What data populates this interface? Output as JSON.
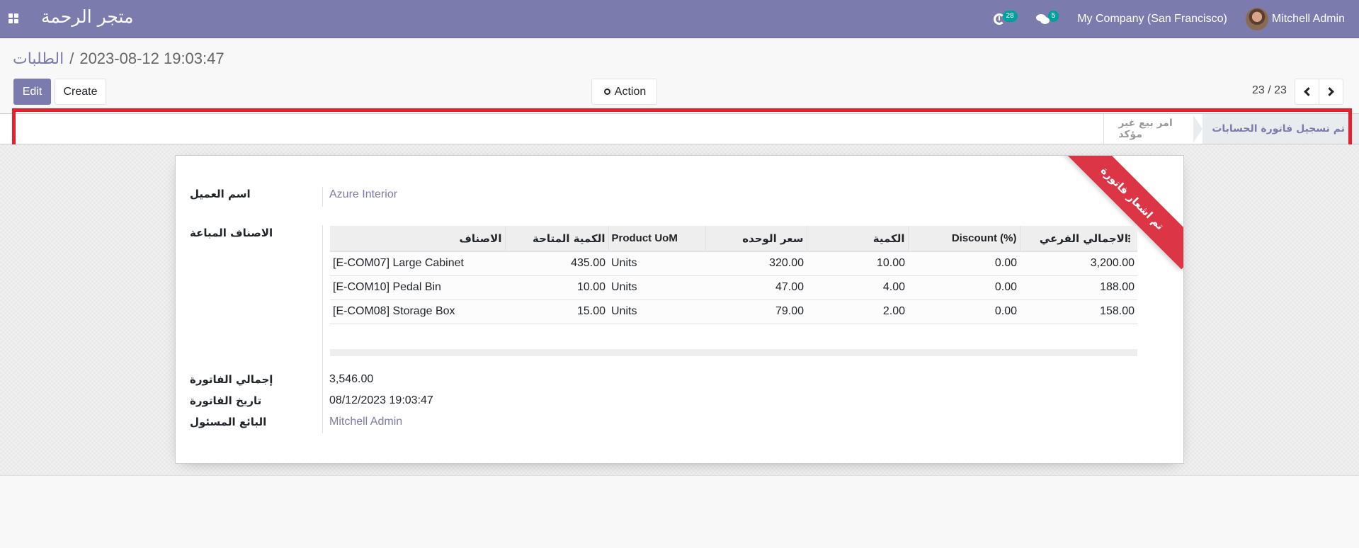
{
  "navbar": {
    "app_title": "متجر الرحمة",
    "activity_count": "28",
    "message_count": "5",
    "company": "My Company (San Francisco)",
    "user": "Mitchell Admin"
  },
  "breadcrumb": {
    "parent": "الطلبات",
    "separator": "/",
    "current": "2023-08-12 19:03:47"
  },
  "toolbar": {
    "edit_label": "Edit",
    "create_label": "Create",
    "action_label": "Action"
  },
  "pager": {
    "value": "23 / 23"
  },
  "statusbar": {
    "steps": [
      {
        "label": "تم تسجيل فاتورة الحسابات",
        "active": true
      },
      {
        "label": "امر بيع غير مؤكد",
        "active": false
      }
    ]
  },
  "ribbon": {
    "text": "تم اشعار فاتورة",
    "color": "#dc3545"
  },
  "form": {
    "customer_label": "اسم العميل",
    "customer_value": "Azure Interior",
    "lines_label": "الاصناف المباعة",
    "lines": {
      "columns": [
        "الاصناف",
        "الكمية المتاحة",
        "Product UoM",
        "سعر الوحده",
        "الكمية",
        "Discount (%)",
        "الاجمالي الفرعي"
      ],
      "rows": [
        [
          "[E-COM07] Large Cabinet",
          "435.00",
          "Units",
          "320.00",
          "10.00",
          "0.00",
          "3,200.00"
        ],
        [
          "[E-COM10] Pedal Bin",
          "10.00",
          "Units",
          "47.00",
          "4.00",
          "0.00",
          "188.00"
        ],
        [
          "[E-COM08] Storage Box",
          "15.00",
          "Units",
          "79.00",
          "2.00",
          "0.00",
          "158.00"
        ]
      ]
    },
    "invoice_total_label": "إجمالي الفاتورة",
    "invoice_total_value": "3,546.00",
    "invoice_date_label": "تاريخ الفاتورة",
    "invoice_date_value": "08/12/2023 19:03:47",
    "salesperson_label": "البائع المسئول",
    "salesperson_value": "Mitchell Admin"
  },
  "colors": {
    "brand": "#7c7bad",
    "badge": "#00a09d",
    "highlight": "#e3202d"
  }
}
